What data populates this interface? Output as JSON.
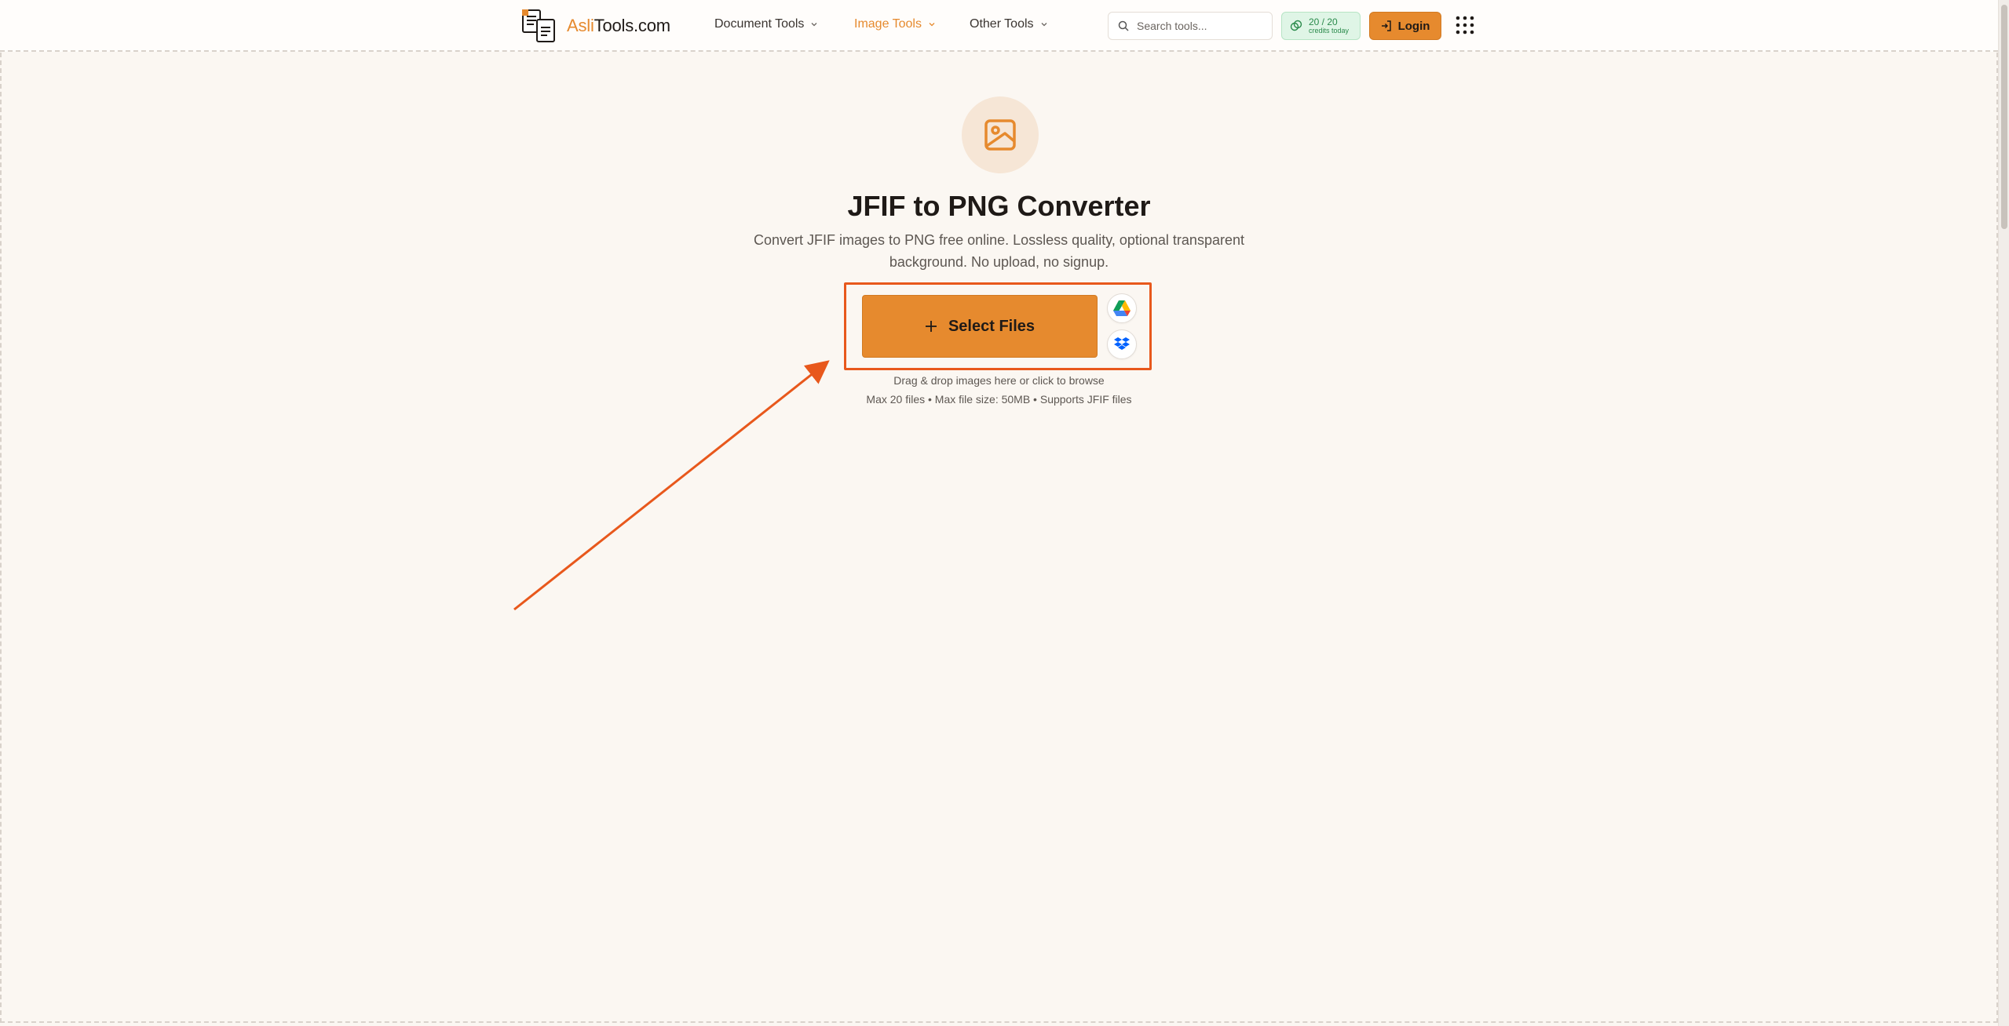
{
  "header": {
    "logo": {
      "accent": "Asli",
      "rest": "Tools.com"
    },
    "nav": [
      {
        "label": "Document Tools"
      },
      {
        "label": "Image Tools"
      },
      {
        "label": "Other Tools"
      }
    ],
    "search": {
      "placeholder": "Search tools..."
    },
    "credits": {
      "count": "20 / 20",
      "caption": "credits today"
    },
    "login_label": "Login"
  },
  "hero": {
    "icon": "image-icon",
    "title": "JFIF to PNG Converter",
    "subtitle": "Convert JFIF images to PNG free online. Lossless quality, optional transparent background. No upload, no signup."
  },
  "upload": {
    "button_label": "Select Files",
    "hint": "Drag & drop images here or click to browse",
    "limits": "Max 20 files • Max file size: 50MB • Supports JFIF files",
    "sources": [
      "google-drive-icon",
      "dropbox-icon"
    ]
  },
  "colors": {
    "accent": "#e68a2e",
    "annotation": "#e8581c",
    "credits_bg": "#dff5e6",
    "background": "#fbf7f2"
  }
}
